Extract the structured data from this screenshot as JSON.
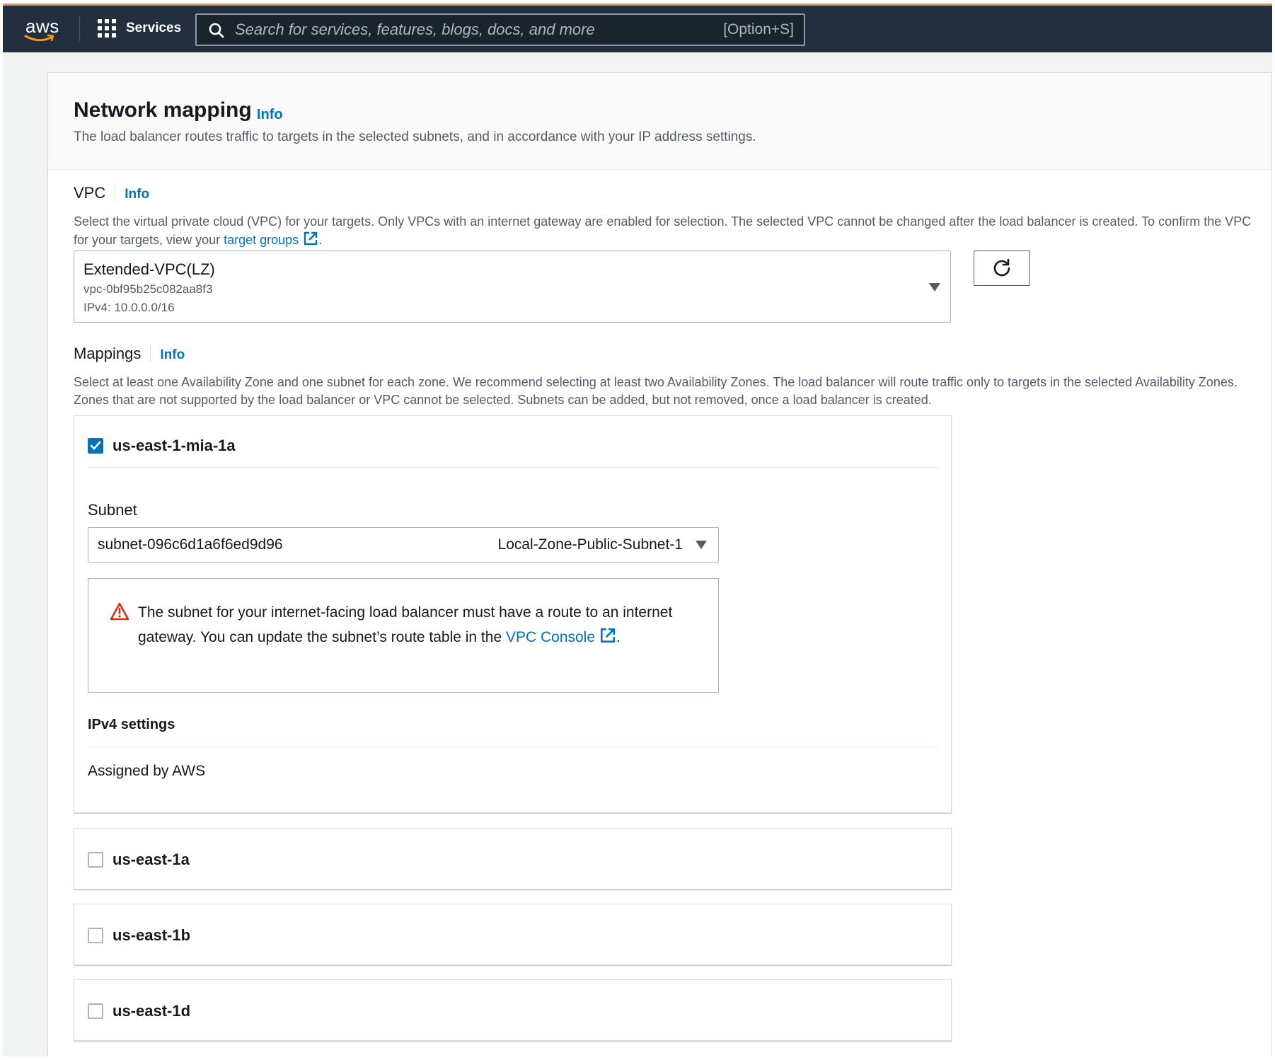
{
  "topnav": {
    "logo_text": "aws",
    "services_label": "Services",
    "search_placeholder": "Search for services, features, blogs, docs, and more",
    "search_shortcut": "[Option+S]"
  },
  "network_mapping": {
    "title": "Network mapping",
    "info": "Info",
    "description": "The load balancer routes traffic to targets in the selected subnets, and in accordance with your IP address settings."
  },
  "vpc": {
    "label": "VPC",
    "info": "Info",
    "description_part1": "Select the virtual private cloud (VPC) for your targets. Only VPCs with an internet gateway are enabled for selection. The selected VPC cannot be changed after the load balancer is created. To confirm the VPC for your targets, view your",
    "link_text": "target groups",
    "description_end": ".",
    "selected_name": "Extended-VPC(LZ)",
    "selected_id": "vpc-0bf95b25c082aa8f3",
    "selected_cidr": "IPv4: 10.0.0.0/16"
  },
  "mappings": {
    "label": "Mappings",
    "info": "Info",
    "description": "Select at least one Availability Zone and one subnet for each zone. We recommend selecting at least two Availability Zones. The load balancer will route traffic only to targets in the selected Availability Zones. Zones that are not supported by the load balancer or VPC cannot be selected. Subnets can be added, but not removed, once a load balancer is created.",
    "zones": [
      {
        "name": "us-east-1-mia-1a",
        "checked": true,
        "subnet_label": "Subnet",
        "subnet_id": "subnet-096c6d1a6f6ed9d96",
        "subnet_name": "Local-Zone-Public-Subnet-1",
        "alert_text": "The subnet for your internet-facing load balancer must have a route to an internet gateway. You can update the subnet’s route table in the",
        "alert_link": "VPC Console",
        "alert_end": ".",
        "ipv4_heading": "IPv4 settings",
        "ipv4_value": "Assigned by AWS"
      },
      {
        "name": "us-east-1a",
        "checked": false
      },
      {
        "name": "us-east-1b",
        "checked": false
      },
      {
        "name": "us-east-1d",
        "checked": false
      }
    ]
  },
  "colors": {
    "nav_bg": "#232f3e",
    "accent_orange": "#d89b43",
    "link_blue": "#0073bb",
    "warning_red": "#d13212"
  }
}
